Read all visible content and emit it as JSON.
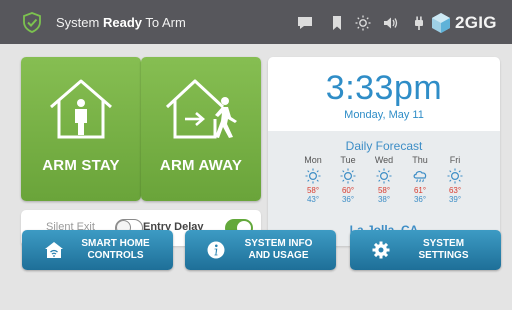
{
  "status_bar": {
    "status_prefix": "System",
    "status_bold": "Ready",
    "status_suffix": "To Arm",
    "icons": [
      "shield-check-icon",
      "message-icon",
      "bookmark-icon",
      "brightness-icon",
      "volume-icon",
      "power-plug-icon"
    ],
    "brand": "2GIG"
  },
  "arm_tiles": {
    "stay_label": "ARM STAY",
    "away_label": "ARM AWAY"
  },
  "toggles": {
    "silent_exit_label": "Silent Exit",
    "silent_exit_on": false,
    "entry_delay_label": "Entry Delay",
    "entry_delay_on": true
  },
  "clock": {
    "time": "3:33pm",
    "date": "Monday, May 11"
  },
  "forecast": {
    "title": "Daily Forecast",
    "days": [
      {
        "day": "Mon",
        "icon": "sun-icon",
        "high": "58°",
        "low": "43°"
      },
      {
        "day": "Tue",
        "icon": "sun-icon",
        "high": "60°",
        "low": "36°"
      },
      {
        "day": "Wed",
        "icon": "sun-icon",
        "high": "58°",
        "low": "38°"
      },
      {
        "day": "Thu",
        "icon": "rain-cloud-icon",
        "high": "61°",
        "low": "36°"
      },
      {
        "day": "Fri",
        "icon": "sun-icon",
        "high": "63°",
        "low": "39°"
      }
    ],
    "location": "La Jolla, CA"
  },
  "bottom_buttons": {
    "smart_home_line1": "SMART HOME",
    "smart_home_line2": "CONTROLS",
    "system_info_line1": "SYSTEM INFO",
    "system_info_line2": "AND USAGE",
    "system_settings_line1": "SYSTEM",
    "system_settings_line2": "SETTINGS"
  },
  "colors": {
    "arm_green": "#6aa43a",
    "accent_blue": "#2f8dc7",
    "status_bar": "#57575c",
    "high_temp": "#d83c30"
  }
}
